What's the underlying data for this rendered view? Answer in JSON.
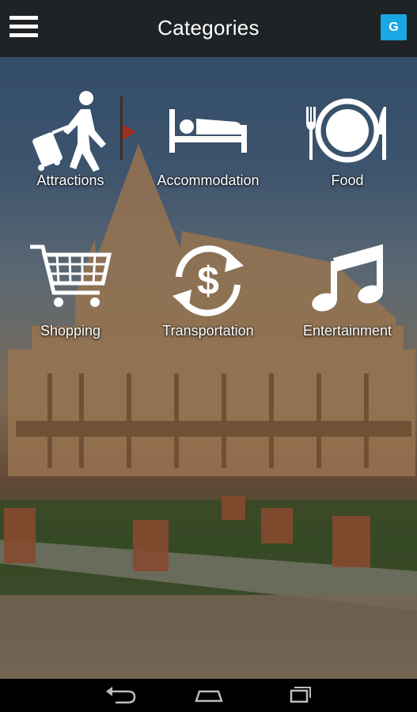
{
  "app_bar": {
    "title": "Categories",
    "account_badge": "G",
    "accent_color": "#1aa7e6"
  },
  "categories": [
    {
      "label": "Attractions",
      "icon": "traveler-with-luggage-icon"
    },
    {
      "label": "Accommodation",
      "icon": "bed-icon"
    },
    {
      "label": "Food",
      "icon": "plate-fork-knife-icon"
    },
    {
      "label": "Shopping",
      "icon": "shopping-cart-icon"
    },
    {
      "label": "Transportation",
      "icon": "dollar-exchange-icon"
    },
    {
      "label": "Entertainment",
      "icon": "music-note-icon"
    }
  ],
  "nav_bar": {
    "buttons": [
      "back-icon",
      "home-icon",
      "recent-apps-icon"
    ]
  }
}
